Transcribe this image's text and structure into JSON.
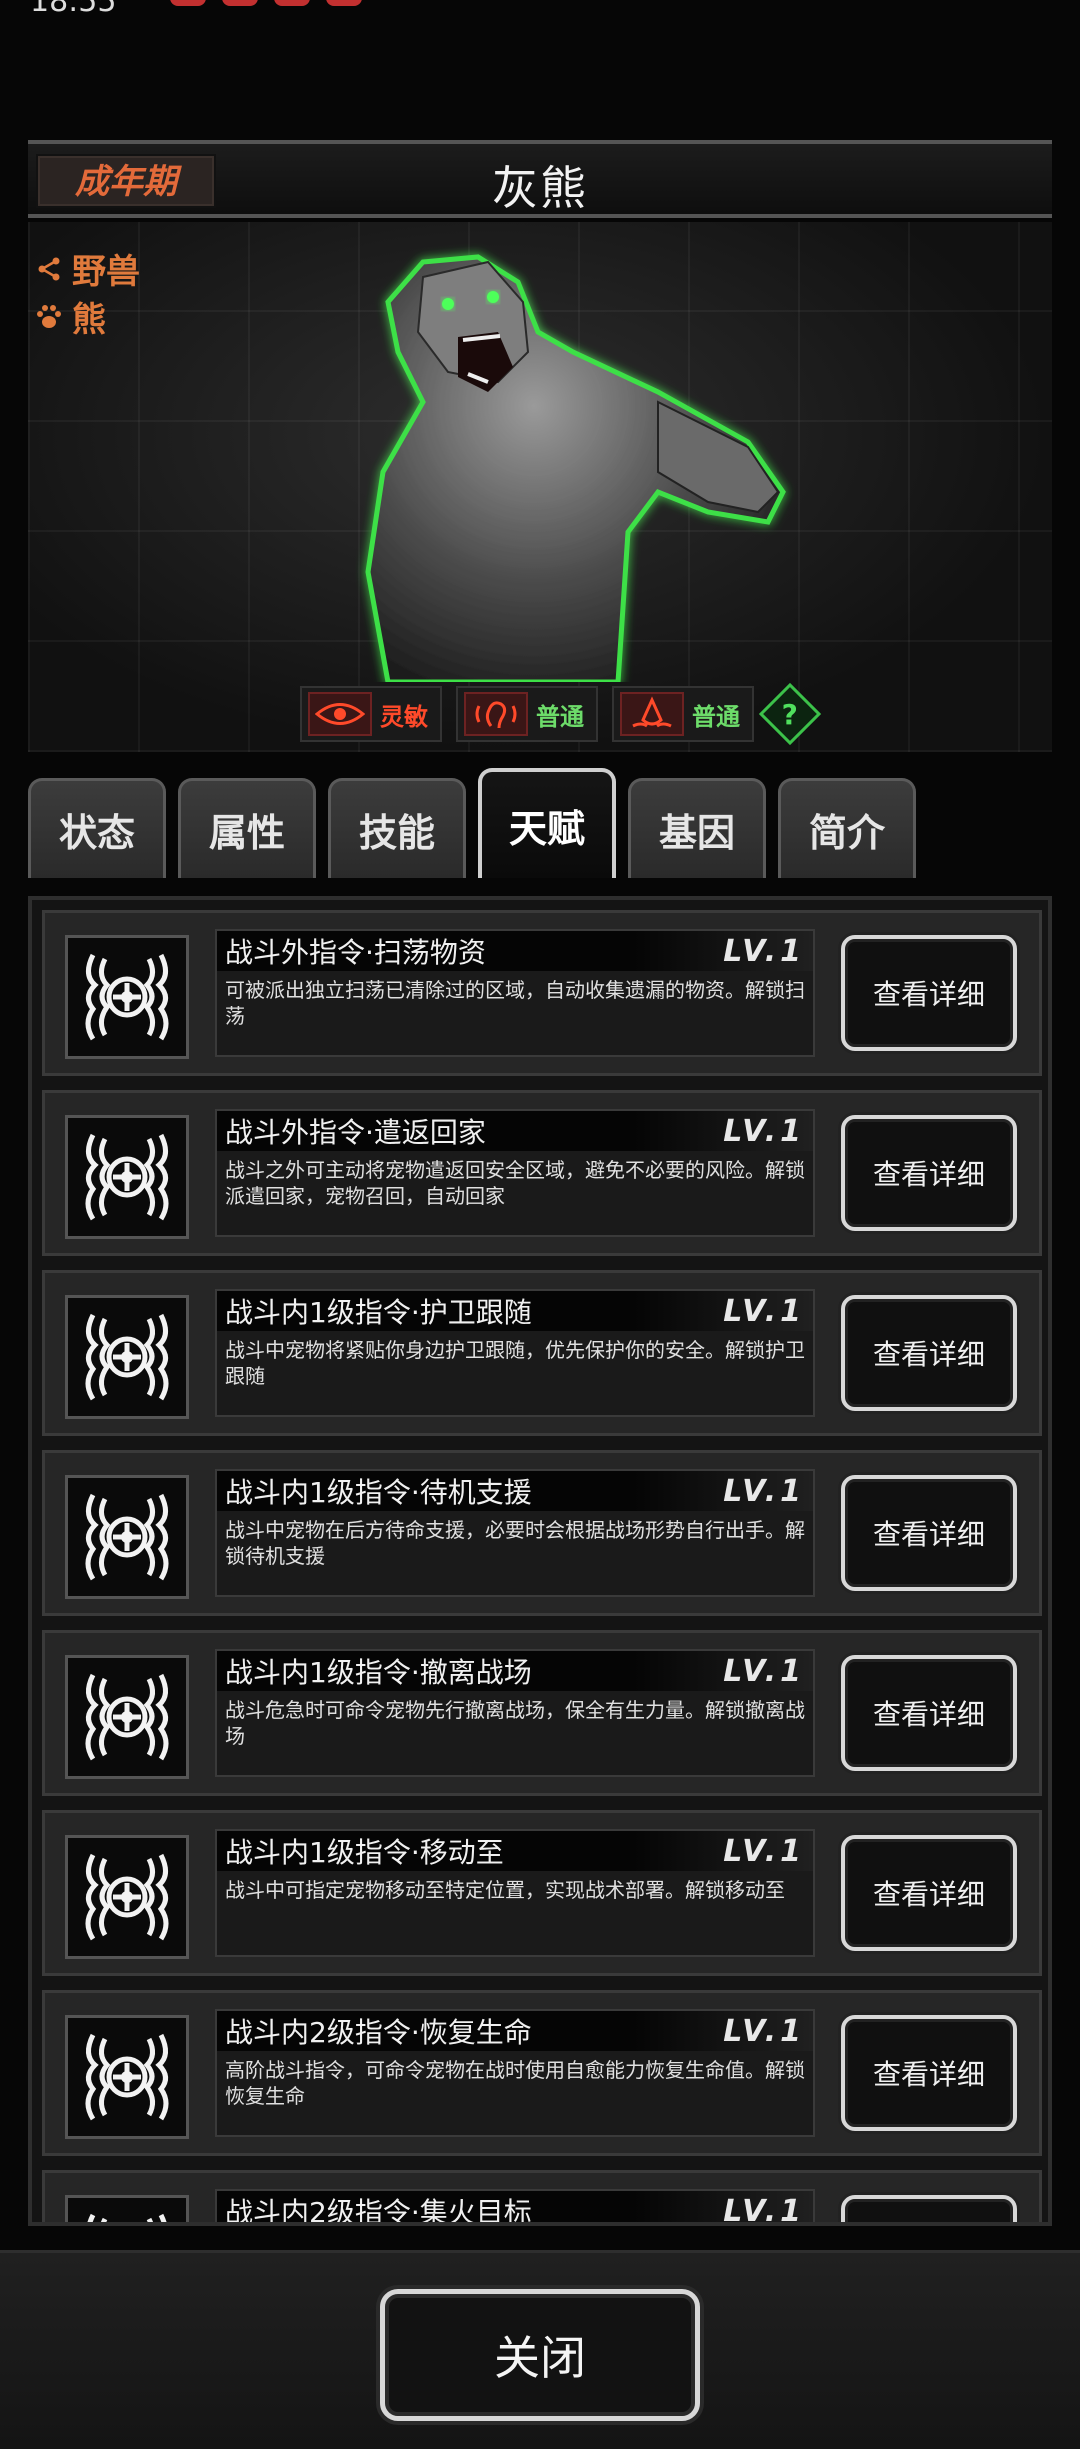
{
  "creature": {
    "stage": "成年期",
    "name": "灰熊",
    "tags": [
      {
        "icon": "share-icon",
        "label": "野兽"
      },
      {
        "icon": "paw-icon",
        "label": "熊"
      }
    ],
    "senses": [
      {
        "icon": "eye-icon",
        "label": "灵敏",
        "color": "#ff4a2a"
      },
      {
        "icon": "ear-icon",
        "label": "普通",
        "color": "#6ddc6a"
      },
      {
        "icon": "nose-icon",
        "label": "普通",
        "color": "#6ddc6a"
      }
    ],
    "help_label": "?"
  },
  "tabs": [
    "状态",
    "属性",
    "技能",
    "天赋",
    "基因",
    "简介"
  ],
  "active_tab": "天赋",
  "talents": [
    {
      "title": "战斗外指令·扫荡物资",
      "level": "LV.1",
      "desc": "可被派出独立扫荡已清除过的区域，自动收集遗漏的物资。解锁扫荡"
    },
    {
      "title": "战斗外指令·遣返回家",
      "level": "LV.1",
      "desc": "战斗之外可主动将宠物遣返回安全区域，避免不必要的风险。解锁派遣回家，宠物召回，自动回家"
    },
    {
      "title": "战斗内1级指令·护卫跟随",
      "level": "LV.1",
      "desc": "战斗中宠物将紧贴你身边护卫跟随，优先保护你的安全。解锁护卫跟随"
    },
    {
      "title": "战斗内1级指令·待机支援",
      "level": "LV.1",
      "desc": "战斗中宠物在后方待命支援，必要时会根据战场形势自行出手。解锁待机支援"
    },
    {
      "title": "战斗内1级指令·撤离战场",
      "level": "LV.1",
      "desc": "战斗危急时可命令宠物先行撤离战场，保全有生力量。解锁撤离战场"
    },
    {
      "title": "战斗内1级指令·移动至",
      "level": "LV.1",
      "desc": "战斗中可指定宠物移动至特定位置，实现战术部署。解锁移动至"
    },
    {
      "title": "战斗内2级指令·恢复生命",
      "level": "LV.1",
      "desc": "高阶战斗指令，可命令宠物在战时使用自愈能力恢复生命值。解锁恢复生命"
    },
    {
      "title": "战斗内2级指令·集火目标",
      "level": "LV.1",
      "desc": ""
    }
  ],
  "detail_button_label": "查看详细",
  "close_button_label": "关闭"
}
